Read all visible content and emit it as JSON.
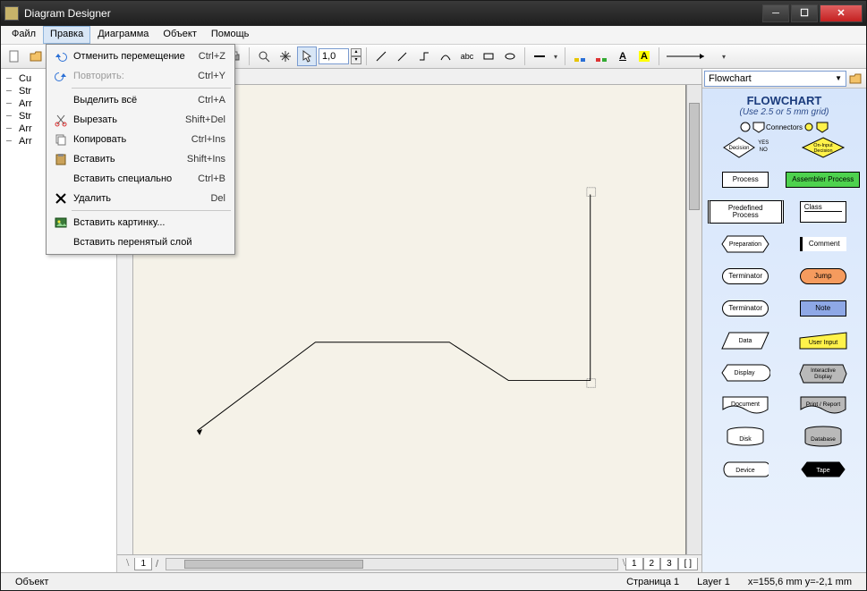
{
  "window": {
    "title": "Diagram Designer"
  },
  "menubar": {
    "items": [
      "Файл",
      "Правка",
      "Диаграмма",
      "Объект",
      "Помощь"
    ],
    "open_index": 1
  },
  "edit_menu": {
    "items": [
      {
        "label": "Отменить перемещение",
        "shortcut": "Ctrl+Z",
        "icon": "undo-icon",
        "disabled": false
      },
      {
        "label": "Повторить:",
        "shortcut": "Ctrl+Y",
        "icon": "redo-icon",
        "disabled": true
      },
      {
        "sep": true
      },
      {
        "label": "Выделить всё",
        "shortcut": "Ctrl+A",
        "icon": "",
        "disabled": false
      },
      {
        "label": "Вырезать",
        "shortcut": "Shift+Del",
        "icon": "cut-icon",
        "disabled": false
      },
      {
        "label": "Копировать",
        "shortcut": "Ctrl+Ins",
        "icon": "copy-icon",
        "disabled": false
      },
      {
        "label": "Вставить",
        "shortcut": "Shift+Ins",
        "icon": "paste-icon",
        "disabled": false
      },
      {
        "label": "Вставить специально",
        "shortcut": "Ctrl+B",
        "icon": "",
        "disabled": false
      },
      {
        "label": "Удалить",
        "shortcut": "Del",
        "icon": "delete-icon",
        "disabled": false
      },
      {
        "sep": true
      },
      {
        "label": "Вставить картинку...",
        "shortcut": "",
        "icon": "picture-icon",
        "disabled": false
      },
      {
        "label": "Вставить перенятый слой",
        "shortcut": "",
        "icon": "",
        "disabled": false
      }
    ]
  },
  "toolbar": {
    "zoom": "1,0"
  },
  "tree": {
    "items": [
      "Cu",
      "Str",
      "Arr",
      "Str",
      "Arr",
      "Arr"
    ]
  },
  "pages": {
    "tabs": [
      "1",
      "2",
      "3"
    ],
    "extra": "[ ]"
  },
  "palette": {
    "combo": "Flowchart",
    "title": "FLOWCHART",
    "subtitle": "(Use 2.5 or 5 mm grid)",
    "connectors_label": "Connectors",
    "decision_yes": "YES",
    "decision_no": "NO",
    "shapes": {
      "decision": "Decision",
      "oninput": "On-Input Decision",
      "process": "Process",
      "assembler": "Assembler Process",
      "predefined": "Predefined Process",
      "class": "Class",
      "preparation": "Preparation",
      "comment": "Comment",
      "terminator1": "Terminator",
      "jump": "Jump",
      "terminator2": "Terminator",
      "note": "Note",
      "data": "Data",
      "userinput": "User Input",
      "display": "Display",
      "interactive": "Interactive Display",
      "document": "Document",
      "print": "Print / Report",
      "disk": "Disk",
      "database": "Database",
      "device": "Device",
      "tape": "Tape"
    }
  },
  "statusbar": {
    "left": "Объект",
    "page": "Страница 1",
    "layer": "Layer 1",
    "coords": "x=155,6 mm  y=-2,1 mm"
  }
}
